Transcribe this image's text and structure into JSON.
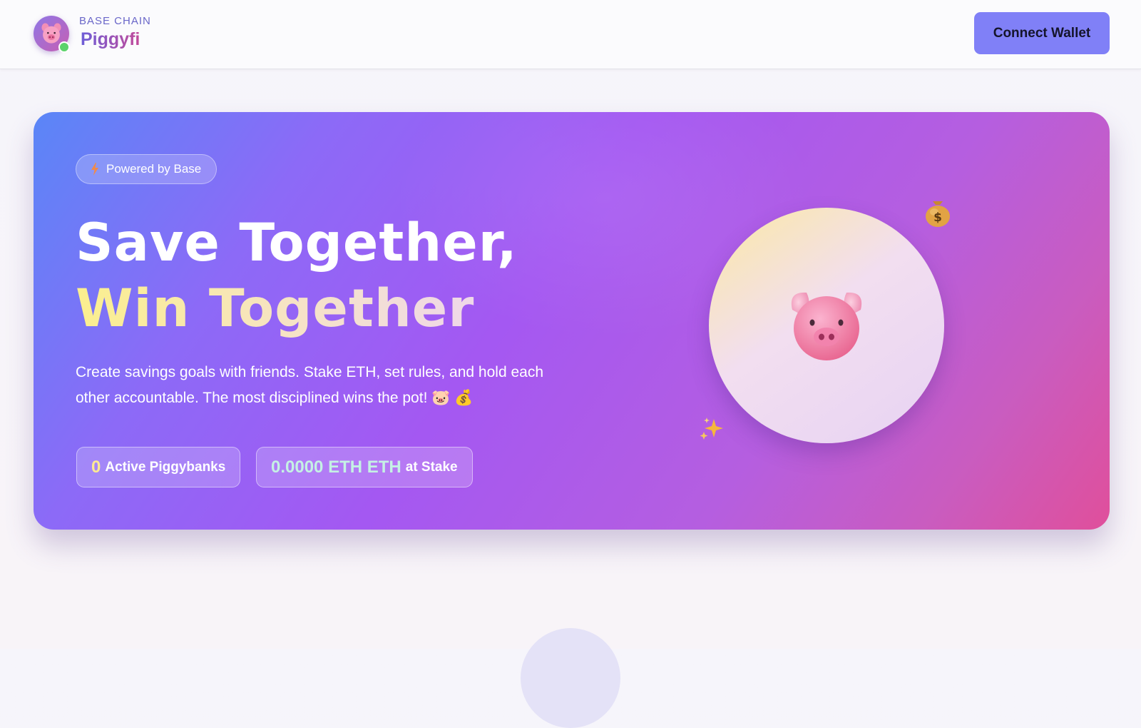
{
  "header": {
    "network_label": "BASE CHAIN",
    "brand_name": "Piggyfi",
    "connect_button_label": "Connect Wallet"
  },
  "hero": {
    "badge_label": "Powered by Base",
    "headline_line1": "Save Together,",
    "headline_line2": "Win Together",
    "description": "Create savings goals with friends. Stake ETH, set rules, and hold each other accountable. The most disciplined wins the pot! 🐷 💰",
    "stats": {
      "active_count": "0",
      "active_label": "Active Piggybanks",
      "stake_value": "0.0000 ETH ETH",
      "stake_label": "at Stake"
    }
  },
  "icons": {
    "logo": "pig-face-icon",
    "status": "online-dot-icon",
    "badge": "lightning-icon",
    "illustration": "pig-face-icon",
    "decor_1": "money-bag-icon",
    "decor_2": "sparkles-icon"
  },
  "colors": {
    "connect_button": "#8080f7",
    "hero_gradient_start": "#5a86f7",
    "hero_gradient_mid": "#a458f2",
    "hero_gradient_end": "#e04f9b",
    "status_online": "#5cd36b",
    "highlight_yellow": "#fbef8e"
  }
}
